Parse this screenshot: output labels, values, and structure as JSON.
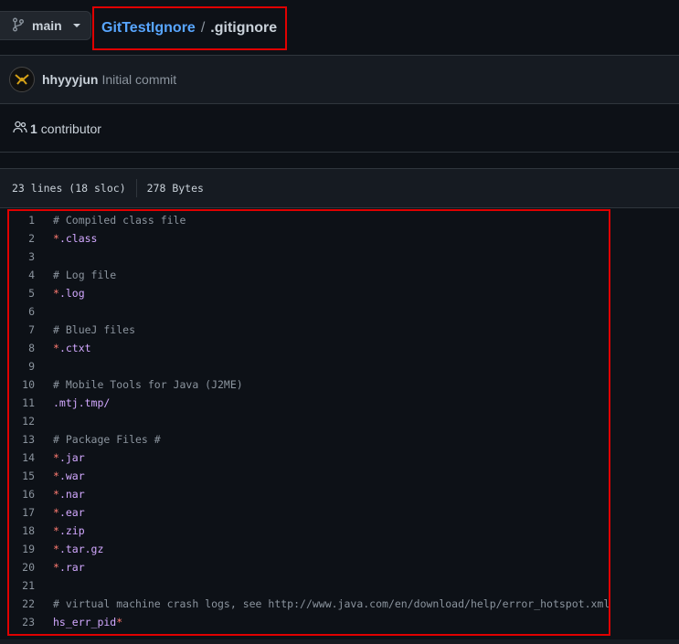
{
  "branch": {
    "label": "main"
  },
  "breadcrumb": {
    "repo": "GitTestIgnore",
    "separator": "/",
    "file": ".gitignore"
  },
  "commit": {
    "author": "hhyyyjun",
    "message": "Initial commit"
  },
  "contributors": {
    "count": "1",
    "label": "contributor"
  },
  "file_info": {
    "lines": "23 lines (18 sloc)",
    "size": "278 Bytes"
  },
  "code_lines": [
    {
      "n": "1",
      "comment": "# Compiled class file",
      "star": "",
      "rest": ""
    },
    {
      "n": "2",
      "comment": "",
      "star": "*",
      "rest": ".class"
    },
    {
      "n": "3",
      "comment": "",
      "star": "",
      "rest": ""
    },
    {
      "n": "4",
      "comment": "# Log file",
      "star": "",
      "rest": ""
    },
    {
      "n": "5",
      "comment": "",
      "star": "*",
      "rest": ".log"
    },
    {
      "n": "6",
      "comment": "",
      "star": "",
      "rest": ""
    },
    {
      "n": "7",
      "comment": "# BlueJ files",
      "star": "",
      "rest": ""
    },
    {
      "n": "8",
      "comment": "",
      "star": "*",
      "rest": ".ctxt"
    },
    {
      "n": "9",
      "comment": "",
      "star": "",
      "rest": ""
    },
    {
      "n": "10",
      "comment": "# Mobile Tools for Java (J2ME)",
      "star": "",
      "rest": ""
    },
    {
      "n": "11",
      "comment": "",
      "star": "",
      "rest": ".mtj.tmp/"
    },
    {
      "n": "12",
      "comment": "",
      "star": "",
      "rest": ""
    },
    {
      "n": "13",
      "comment": "# Package Files #",
      "star": "",
      "rest": ""
    },
    {
      "n": "14",
      "comment": "",
      "star": "*",
      "rest": ".jar"
    },
    {
      "n": "15",
      "comment": "",
      "star": "*",
      "rest": ".war"
    },
    {
      "n": "16",
      "comment": "",
      "star": "*",
      "rest": ".nar"
    },
    {
      "n": "17",
      "comment": "",
      "star": "*",
      "rest": ".ear"
    },
    {
      "n": "18",
      "comment": "",
      "star": "*",
      "rest": ".zip"
    },
    {
      "n": "19",
      "comment": "",
      "star": "*",
      "rest": ".tar.gz"
    },
    {
      "n": "20",
      "comment": "",
      "star": "*",
      "rest": ".rar"
    },
    {
      "n": "21",
      "comment": "",
      "star": "",
      "rest": ""
    },
    {
      "n": "22",
      "comment": "# virtual machine crash logs, see http://www.java.com/en/download/help/error_hotspot.xml",
      "star": "",
      "rest": ""
    },
    {
      "n": "23",
      "comment": "",
      "star": "",
      "rest": "hs_err_pid",
      "trail": "*"
    }
  ],
  "colors": {
    "background": "#0d1117",
    "link": "#58a6ff",
    "highlight_border": "#e00000",
    "comment": "#8b949e",
    "glob_star": "#ff7b72",
    "pattern": "#d2a8ff"
  },
  "icons": {
    "branch": "git-branch-icon",
    "contributors": "people-icon"
  }
}
